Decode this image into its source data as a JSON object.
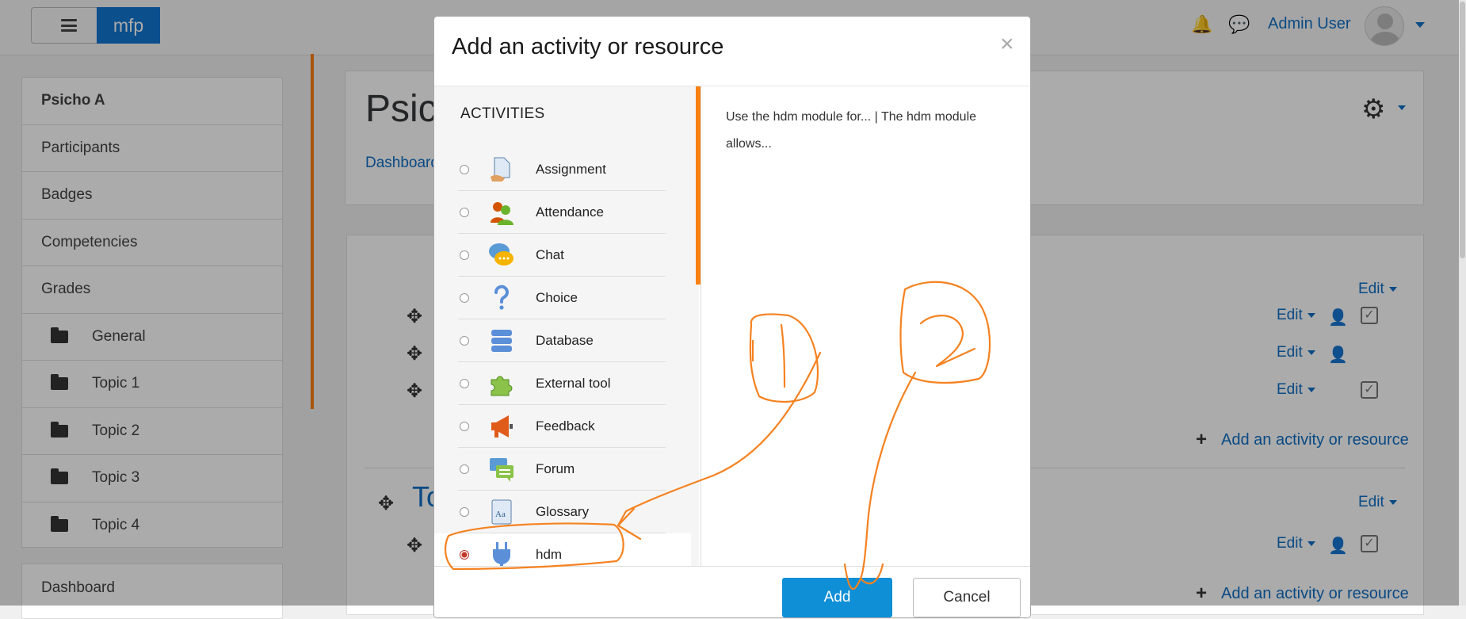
{
  "navbar": {
    "brand": "mfp",
    "user_name": "Admin User"
  },
  "sidebar": {
    "course": "Psicho A",
    "items": [
      "Participants",
      "Badges",
      "Competencies",
      "Grades"
    ],
    "folders": [
      "General",
      "Topic 1",
      "Topic 2",
      "Topic 3",
      "Topic 4"
    ],
    "dashboard": "Dashboard"
  },
  "header": {
    "title": "Psic",
    "breadcrumb": "Dashboard"
  },
  "content": {
    "edit_label": "Edit",
    "add_label": "Add an activity or resource",
    "topic_heading": "To"
  },
  "modal": {
    "title": "Add an activity or resource",
    "close": "×",
    "section_heading": "ACTIVITIES",
    "options": [
      "Assignment",
      "Attendance",
      "Chat",
      "Choice",
      "Database",
      "External tool",
      "Feedback",
      "Forum",
      "Glossary",
      "hdm"
    ],
    "selected": "hdm",
    "description": "Use the hdm module for... | The hdm module allows...",
    "add_button": "Add",
    "cancel_button": "Cancel"
  },
  "colors": {
    "accent": "#0f6fc5",
    "brand": "#1177d1",
    "orange": "#f98012",
    "annotation": "#f58220"
  }
}
